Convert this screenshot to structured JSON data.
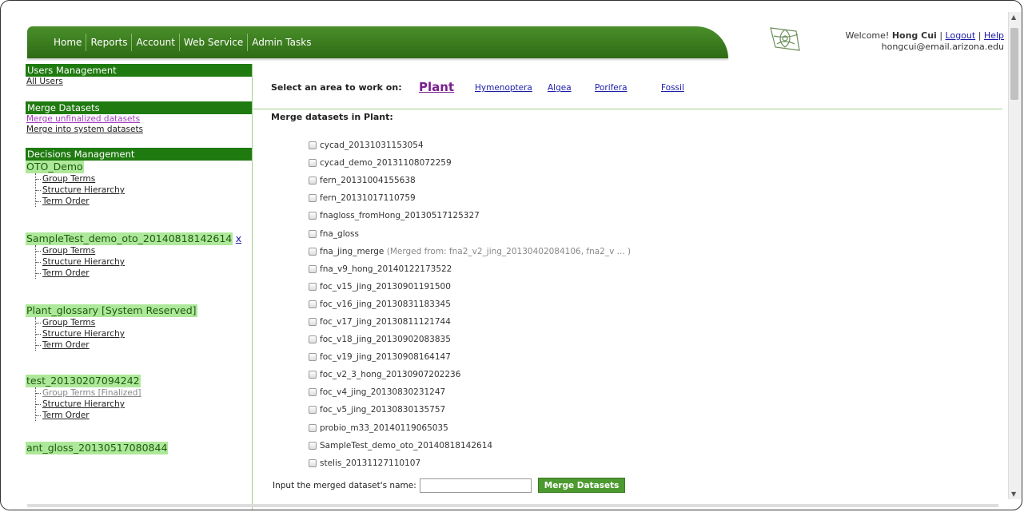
{
  "nav": {
    "items": [
      "Home",
      "Reports",
      "Account",
      "Web Service",
      "Admin Tasks"
    ]
  },
  "welcome": {
    "prefix": "Welcome!",
    "user": "Hong Cui",
    "sep1": "|",
    "logout": "Logout",
    "sep2": "|",
    "help": "Help",
    "email": "hongcui@email.arizona.edu"
  },
  "sidebar": {
    "users_head": "Users Management",
    "all_users": "All Users",
    "merge_head": "Merge Datasets",
    "merge_unfinalized": "Merge unfinalized datasets",
    "merge_system": "Merge into system datasets",
    "decisions_head": "Decisions Management",
    "close_x": "x",
    "datasets": [
      {
        "name": "OTO_Demo",
        "links": [
          "Group Terms",
          "Structure Hierarchy",
          "Term Order"
        ]
      },
      {
        "name": "SampleTest_demo_oto_20140818142614",
        "links": [
          "Group Terms",
          "Structure Hierarchy",
          "Term Order"
        ]
      },
      {
        "name": "Plant_glossary [System Reserved]",
        "links": [
          "Group Terms",
          "Structure Hierarchy",
          "Term Order"
        ]
      },
      {
        "name": "test_20130207094242",
        "links": [
          "Group Terms [Finalized]",
          "Structure Hierarchy",
          "Term Order"
        ]
      },
      {
        "name": "ant_gloss_20130517080844",
        "links": []
      }
    ]
  },
  "area": {
    "label": "Select an area to work on:",
    "options": [
      "Plant",
      "Hymenoptera",
      "Algea",
      "Porifera",
      "Fossil"
    ],
    "selected": "Plant"
  },
  "merge": {
    "title": "Merge datasets in Plant:",
    "datasets": [
      "cycad_20131031153054",
      "cycad_demo_20131108072259",
      "fern_20131004155638",
      "fern_20131017110759",
      "fnagloss_fromHong_20130517125327",
      "fna_gloss",
      "fna_jing_merge",
      "fna_v9_hong_20140122173522",
      "foc_v15_jing_20130901191500",
      "foc_v16_jing_20130831183345",
      "foc_v17_jing_20130811121744",
      "foc_v18_jing_20130902083835",
      "foc_v19_jing_20130908164147",
      "foc_v2_3_hong_20130907202236",
      "foc_v4_jing_20130830231247",
      "foc_v5_jing_20130830135757",
      "probio_m33_20140119065035",
      "SampleTest_demo_oto_20140818142614",
      "stelis_20131127110107"
    ],
    "fna_jing_merge_note": "(Merged from: fna2_v2_jing_20130402084106, fna2_v ... )",
    "name_label": "Input the merged dataset's name:",
    "name_value": "",
    "button": "Merge Datasets"
  }
}
